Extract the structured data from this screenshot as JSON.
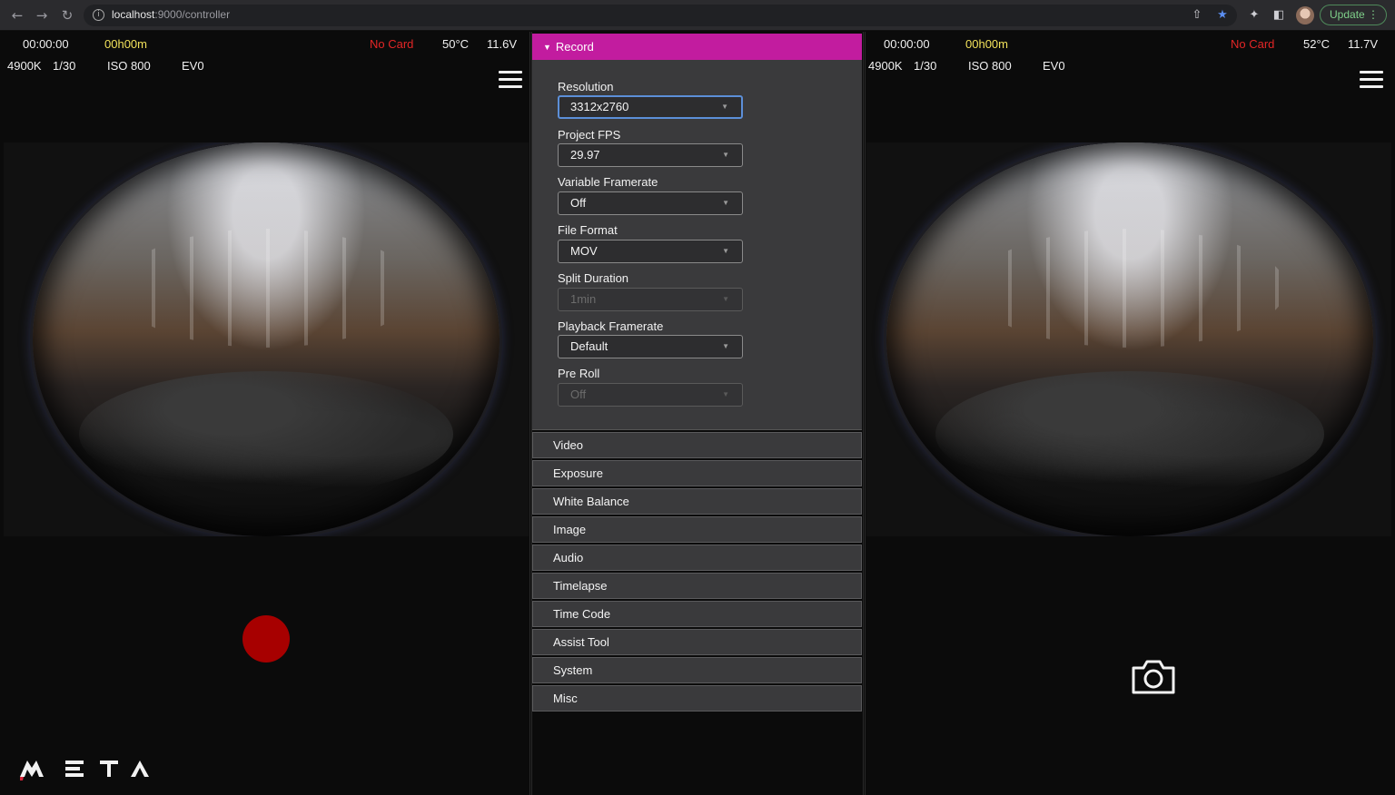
{
  "browser": {
    "url_host": "localhost",
    "url_path": ":9000/controller",
    "update_label": "Update"
  },
  "left_camera": {
    "timecode": "00:00:00",
    "remaining": "00h00m",
    "card_status": "No Card",
    "temperature": "50°C",
    "voltage": "11.6V",
    "white_balance": "4900K",
    "shutter": "1/30",
    "iso": "ISO 800",
    "ev": "EV0"
  },
  "right_camera": {
    "timecode": "00:00:00",
    "remaining": "00h00m",
    "card_status": "No Card",
    "temperature": "52°C",
    "voltage": "11.7V",
    "white_balance": "4900K",
    "shutter": "1/30",
    "iso": "ISO 800",
    "ev": "EV0"
  },
  "settings": {
    "record_header": "Record",
    "fields": [
      {
        "label": "Resolution",
        "value": "3312x2760",
        "state": "focused"
      },
      {
        "label": "Project FPS",
        "value": "29.97",
        "state": "normal"
      },
      {
        "label": "Variable Framerate",
        "value": "Off",
        "state": "normal"
      },
      {
        "label": "File Format",
        "value": "MOV",
        "state": "normal"
      },
      {
        "label": "Split Duration",
        "value": "1min",
        "state": "disabled"
      },
      {
        "label": "Playback Framerate",
        "value": "Default",
        "state": "normal"
      },
      {
        "label": "Pre Roll",
        "value": "Off",
        "state": "disabled"
      }
    ],
    "sections": [
      "Video",
      "Exposure",
      "White Balance",
      "Image",
      "Audio",
      "Timelapse",
      "Time Code",
      "Assist Tool",
      "System",
      "Misc"
    ]
  },
  "colors": {
    "accent": "#c21c9f",
    "record_button": "#a70000",
    "warning": "#e32626",
    "remaining_time": "#f1e15a"
  },
  "icons": [
    "back-arrow-icon",
    "forward-arrow-icon",
    "reload-icon",
    "info-icon",
    "share-icon",
    "bookmark-star-icon",
    "extensions-icon",
    "sidebar-icon",
    "menu-hamburger-icon",
    "camera-icon",
    "record-button"
  ],
  "logo_text": "META"
}
